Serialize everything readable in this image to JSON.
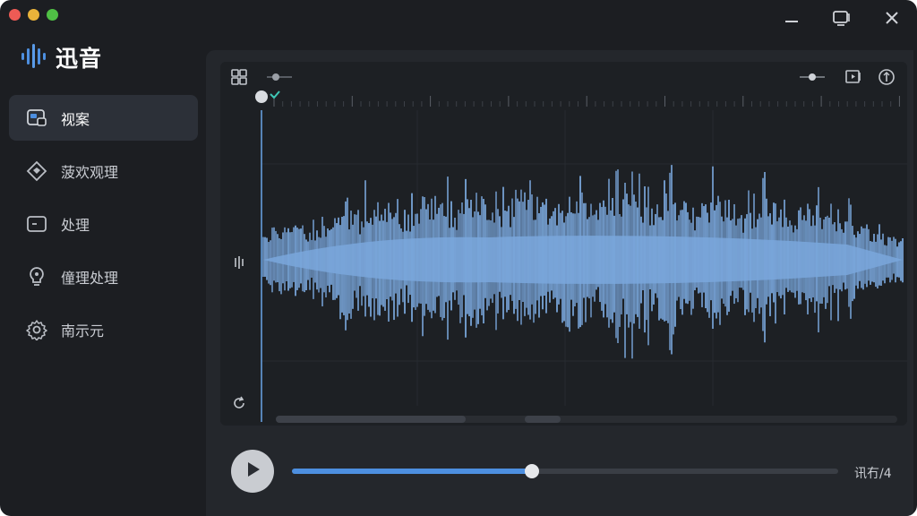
{
  "app": {
    "title": "迅音",
    "logo_icon": "soundwave-icon",
    "brand_color": "#4d8fe0"
  },
  "window_controls": {
    "buttons": [
      "minimize-icon",
      "restore-icon",
      "close-icon"
    ]
  },
  "sidebar": {
    "items": [
      {
        "label": "视案",
        "icon": "project-icon",
        "active": true
      },
      {
        "label": "菠欢观理",
        "icon": "diamond-icon",
        "active": false
      },
      {
        "label": "处理",
        "icon": "screen-icon",
        "active": false
      },
      {
        "label": "僮理处理",
        "icon": "bulb-icon",
        "active": false
      },
      {
        "label": "南示元",
        "icon": "gear-icon",
        "active": false
      }
    ]
  },
  "editor": {
    "toolbar_left": [
      "layout-icon",
      "zoom-slider-icon"
    ],
    "toolbar_right": [
      "volume-slider-icon",
      "export-icon",
      "info-icon"
    ],
    "side_icons": [
      "channel-icon",
      "loop-icon"
    ],
    "waveform_color": "#7aa7dc"
  },
  "transport": {
    "play_icon": "play-icon",
    "progress": 0.44,
    "time_label": "讯冇/4"
  }
}
